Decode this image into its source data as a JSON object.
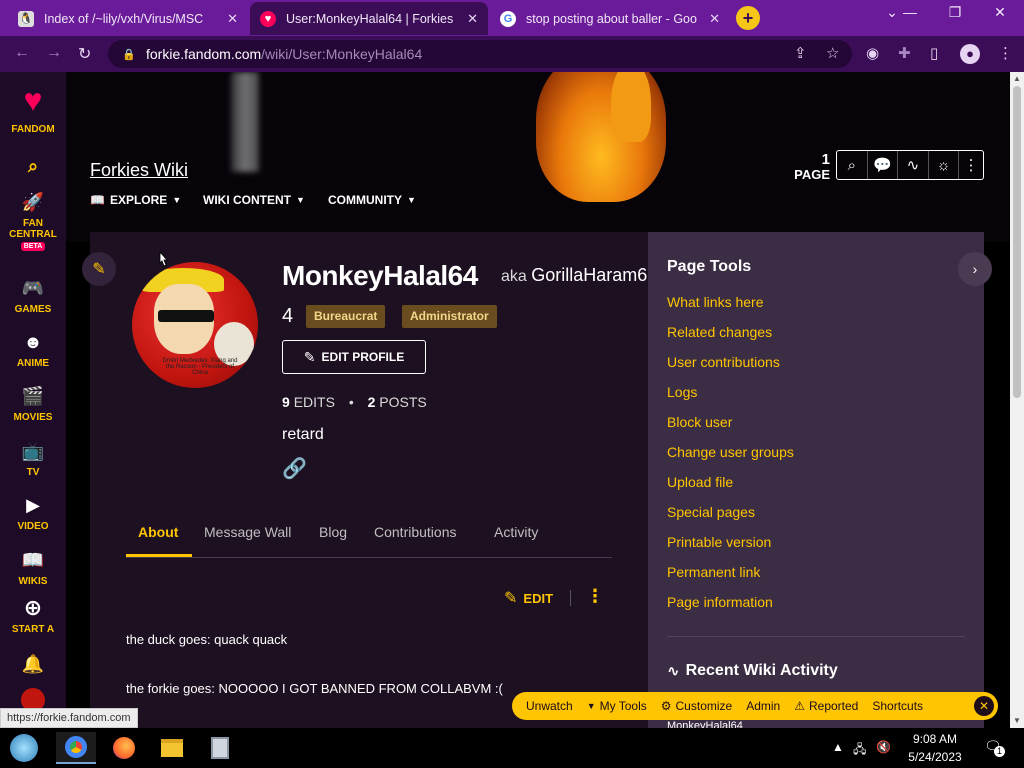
{
  "browser": {
    "tabs": [
      {
        "title": "Index of /~lily/vxh/Virus/MSC",
        "favicon": "tux-icon",
        "active": false
      },
      {
        "title": "User:MonkeyHalal64 | Forkies",
        "favicon": "fandom-icon",
        "active": true
      },
      {
        "title": "stop posting about baller - Goo",
        "favicon": "google-icon",
        "active": false
      }
    ],
    "new_tab": "+",
    "url_host": "forkie.fandom.com",
    "url_path": "/wiki/User:MonkeyHalal64"
  },
  "global_nav": {
    "logo_label": "FANDOM",
    "items": [
      {
        "label": "FAN CENTRAL",
        "icon": "rocket-icon",
        "badge": "BETA"
      },
      {
        "label": "GAMES",
        "icon": "gamepad-icon"
      },
      {
        "label": "ANIME",
        "icon": "anime-face-icon"
      },
      {
        "label": "MOVIES",
        "icon": "clapperboard-icon"
      },
      {
        "label": "TV",
        "icon": "tv-icon"
      },
      {
        "label": "VIDEO",
        "icon": "play-icon"
      },
      {
        "label": "WIKIS",
        "icon": "book-icon"
      },
      {
        "label": "START A",
        "icon": "plus-circle-icon"
      }
    ]
  },
  "wiki": {
    "title": "Forkies Wiki",
    "nav": [
      "EXPLORE",
      "WIKI CONTENT",
      "COMMUNITY"
    ],
    "page_count": "1",
    "page_label": "PAGE"
  },
  "profile": {
    "username": "MonkeyHalal64",
    "aka_label": "aka",
    "aka_name": "GorillaHaram6",
    "tag_count": "4",
    "badges": [
      "Bureaucrat",
      "Administrator"
    ],
    "edit_profile": "EDIT PROFILE",
    "edits_count": "9",
    "edits_label": "EDITS",
    "posts_count": "2",
    "posts_label": "POSTS",
    "bio": "retard",
    "avatar_caption": "Dmitri Medvedev, Xiang and the Racoon - President of China"
  },
  "profile_tabs": [
    "About",
    "Message Wall",
    "Blog",
    "Contributions",
    "Activity"
  ],
  "about": {
    "edit_label": "EDIT",
    "paragraphs": [
      "the duck goes: quack quack",
      "the forkie goes: NOOOOO I GOT BANNED FROM COLLABVM :("
    ]
  },
  "page_tools": {
    "title": "Page Tools",
    "links": [
      "What links here",
      "Related changes",
      "User contributions",
      "Logs",
      "Block user",
      "Change user groups",
      "Upload file",
      "Special pages",
      "Printable version",
      "Permanent link",
      "Page information"
    ],
    "recent_activity": "Recent Wiki Activity",
    "recent_user": "MonkeyHalal64"
  },
  "wiki_toolbar": {
    "items": [
      "Unwatch",
      "My Tools",
      "Customize",
      "Admin",
      "Reported",
      "Shortcuts"
    ]
  },
  "status_url": "https://forkie.fandom.com",
  "taskbar": {
    "time": "9:08 AM",
    "date": "5/24/2023",
    "notification_count": "1"
  },
  "colors": {
    "accent": "#ffc500",
    "browser_frame": "#6a1b99",
    "badge_bg": "#6a4d1e"
  }
}
